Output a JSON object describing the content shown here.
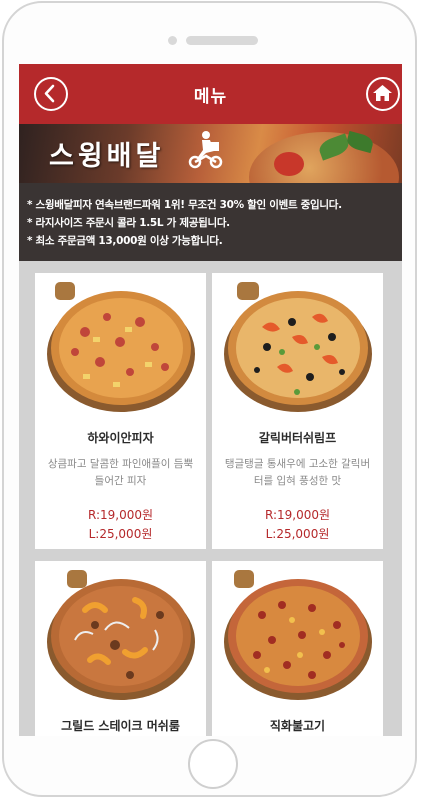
{
  "header": {
    "title": "메뉴",
    "back_icon": "back-arrow-icon",
    "home_icon": "home-icon",
    "color": "#b5292b"
  },
  "banner": {
    "title": "스윙배달"
  },
  "notice": {
    "lines": [
      "* 스윙배달피자 연속브랜드파워 1위! 무조건 30% 할인 이벤트 중입니다.",
      "* 라지사이즈 주문시 콜라 1.5L 가 제공됩니다.",
      "* 최소 주문금액 13,000원 이상 가능합니다."
    ]
  },
  "menu": {
    "items": [
      {
        "name": "하와이안피자",
        "desc": "상큼파고 달콤한 파인애플이 듬뿍 들어간 피자",
        "price_r": "R:19,000원",
        "price_l": "L:25,000원"
      },
      {
        "name": "갈릭버터쉬림프",
        "desc": "탱글탱글 통새우에 고소한 갈릭버터를 입혀 풍성한 맛",
        "price_r": "R:19,000원",
        "price_l": "L:25,000원"
      },
      {
        "name": "그릴드 스테이크 머쉬룸",
        "desc": "",
        "price_r": "",
        "price_l": ""
      },
      {
        "name": "직화불고기",
        "desc": "",
        "price_r": "",
        "price_l": ""
      }
    ]
  }
}
